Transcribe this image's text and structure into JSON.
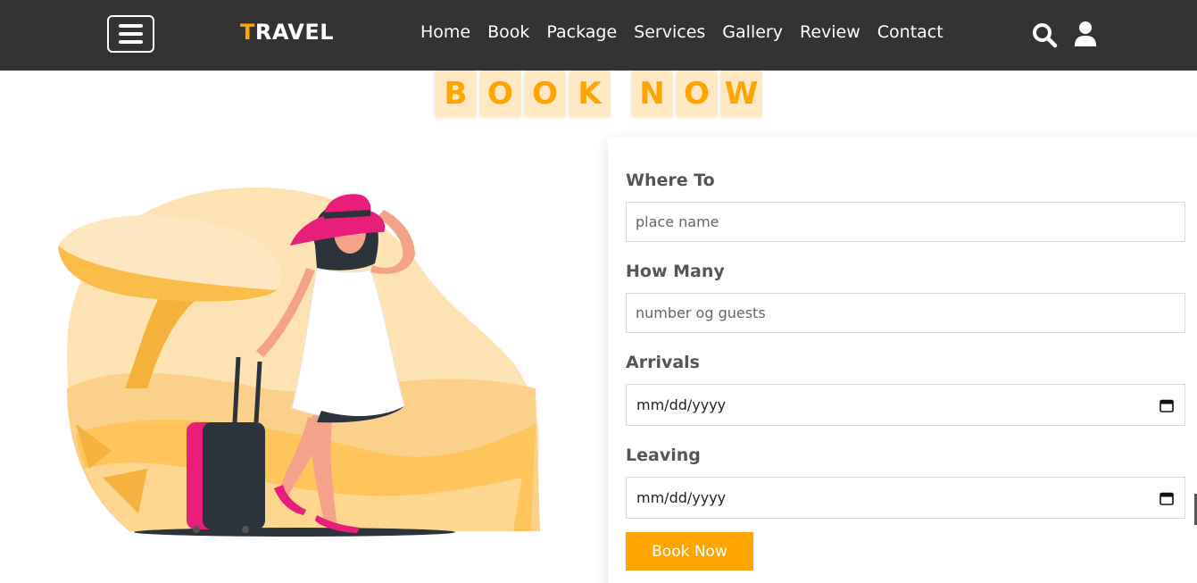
{
  "header": {
    "logo_first": "T",
    "logo_rest": "RAVEL",
    "nav": [
      "Home",
      "Book",
      "Package",
      "Services",
      "Gallery",
      "Review",
      "Contact"
    ],
    "icons": [
      "menu-icon",
      "search-icon",
      "user-icon"
    ]
  },
  "heading": {
    "word1": [
      "B",
      "O",
      "O",
      "K"
    ],
    "word2": [
      "N",
      "O",
      "W"
    ]
  },
  "form": {
    "where_label": "Where To",
    "where_placeholder": "place name",
    "howmany_label": "How Many",
    "howmany_placeholder": "number og guests",
    "arrivals_label": "Arrivals",
    "arrivals_value": "mm/dd/yyyy",
    "leaving_label": "Leaving",
    "leaving_value": "mm/dd/yyyy",
    "submit_label": "Book Now"
  },
  "colors": {
    "accent": "#ffa500",
    "header_bg": "#333333",
    "tile_bg": "#ffe9c4",
    "luggage": "#e91e7a"
  }
}
